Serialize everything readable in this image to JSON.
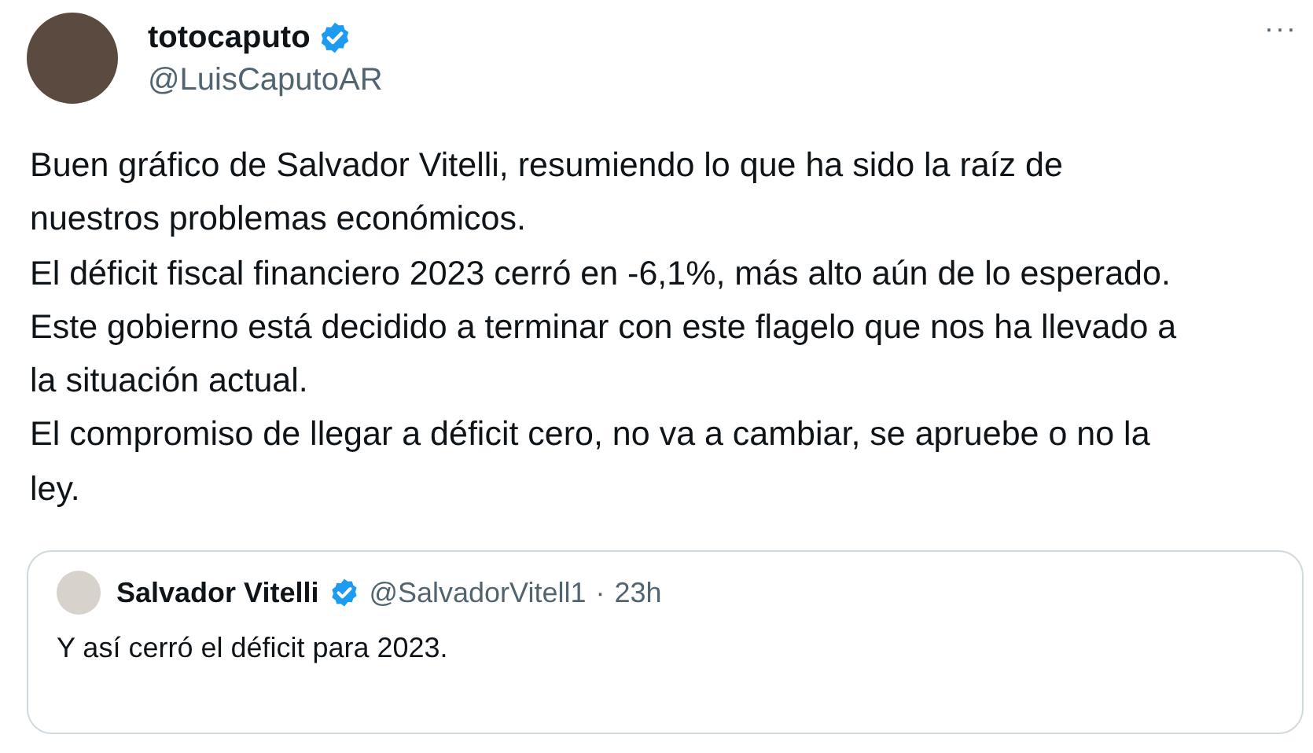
{
  "author": {
    "name": "totocaputo",
    "verified": true,
    "handle": "@LuisCaputoAR"
  },
  "more": "···",
  "paragraphs": [
    "Buen gráfico de Salvador Vitelli, resumiendo lo que ha sido la raíz de nuestros problemas económicos.",
    "El déficit fiscal financiero 2023 cerró en -6,1%, más alto aún de lo esperado.",
    "Este gobierno está decidido a terminar con este flagelo que nos ha llevado a la situación actual.",
    "El compromiso de llegar a déficit cero, no va a cambiar, se apruebe o no la ley."
  ],
  "quote": {
    "name": "Salvador Vitelli",
    "verified": true,
    "handle": "@SalvadorVitell1",
    "separator": "·",
    "time": "23h",
    "text": "Y así cerró el déficit para 2023."
  }
}
